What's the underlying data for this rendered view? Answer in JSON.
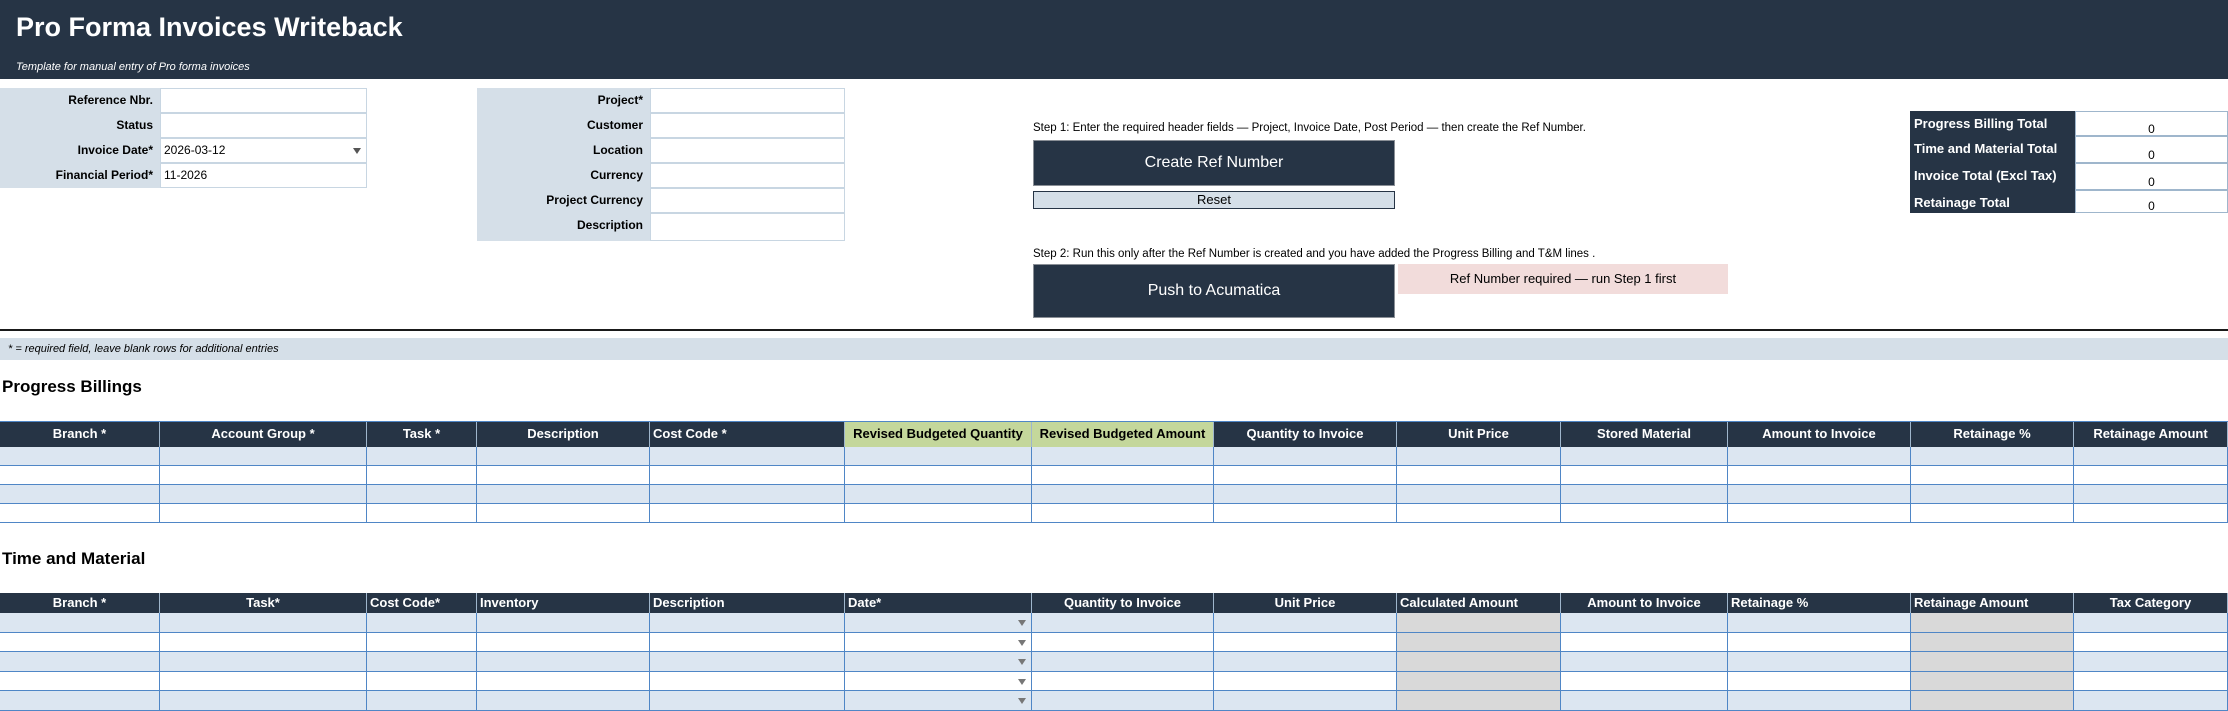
{
  "header": {
    "title": "Pro Forma Invoices Writeback",
    "subtitle": "Template for manual entry of Pro forma invoices"
  },
  "form_left": [
    {
      "label": "Reference Nbr.",
      "value": ""
    },
    {
      "label": "Status",
      "value": ""
    },
    {
      "label": "Invoice Date*",
      "value": "2026-03-12",
      "dropdown": true
    },
    {
      "label": "Financial Period*",
      "value": "11-2026"
    }
  ],
  "form_right": [
    {
      "label": "Project*",
      "value": ""
    },
    {
      "label": "Customer",
      "value": ""
    },
    {
      "label": "Location",
      "value": ""
    },
    {
      "label": "Currency",
      "value": ""
    },
    {
      "label": "Project Currency",
      "value": ""
    },
    {
      "label": "Description",
      "value": ""
    }
  ],
  "steps": {
    "step1_text": "Step 1: Enter the required header fields — Project, Invoice Date, Post Period — then create the Ref Number.",
    "create_button": "Create Ref Number",
    "reset_button": "Reset",
    "step2_text": "Step 2: Run this only after the Ref Number is created and you have added the Progress Billing and T&M lines .",
    "push_button": "Push to Acumatica",
    "warning": "Ref Number required — run Step 1 first"
  },
  "totals": [
    {
      "label": "Progress Billing Total",
      "value": "0"
    },
    {
      "label": "Time and Material Total",
      "value": "0"
    },
    {
      "label": "Invoice Total (Excl Tax)",
      "value": "0"
    },
    {
      "label": "Retainage Total",
      "value": "0"
    }
  ],
  "note": "* = required field, leave blank rows for additional entries",
  "progress_billings": {
    "title": "Progress Billings",
    "columns": [
      "Branch *",
      "Account Group *",
      "Task *",
      "Description",
      "Cost Code *",
      "Revised Budgeted Quantity",
      "Revised Budgeted Amount",
      "Quantity to Invoice",
      "Unit Price",
      "Stored Material",
      "Amount to Invoice",
      "Retainage %",
      "Retainage Amount"
    ],
    "rows": 4
  },
  "time_material": {
    "title": "Time and Material",
    "columns": [
      "Branch *",
      "Task*",
      "Cost Code*",
      "Inventory",
      "Description",
      "Date*",
      "Quantity to Invoice",
      "Unit Price",
      "Calculated Amount",
      "Amount to Invoice",
      "Retainage %",
      "Retainage Amount",
      "Tax Category"
    ],
    "rows": 5
  },
  "colors": {
    "banner": "#263445",
    "label_fill": "#d5dfe8",
    "green_header": "#c4d79b",
    "band_row": "#dce6f1",
    "grid_line": "#4f86c6",
    "warning_fill": "#f2dcdb",
    "calc_fill": "#d9d9d9"
  },
  "icons": {
    "date_dropdown": "chevron-down-icon"
  }
}
